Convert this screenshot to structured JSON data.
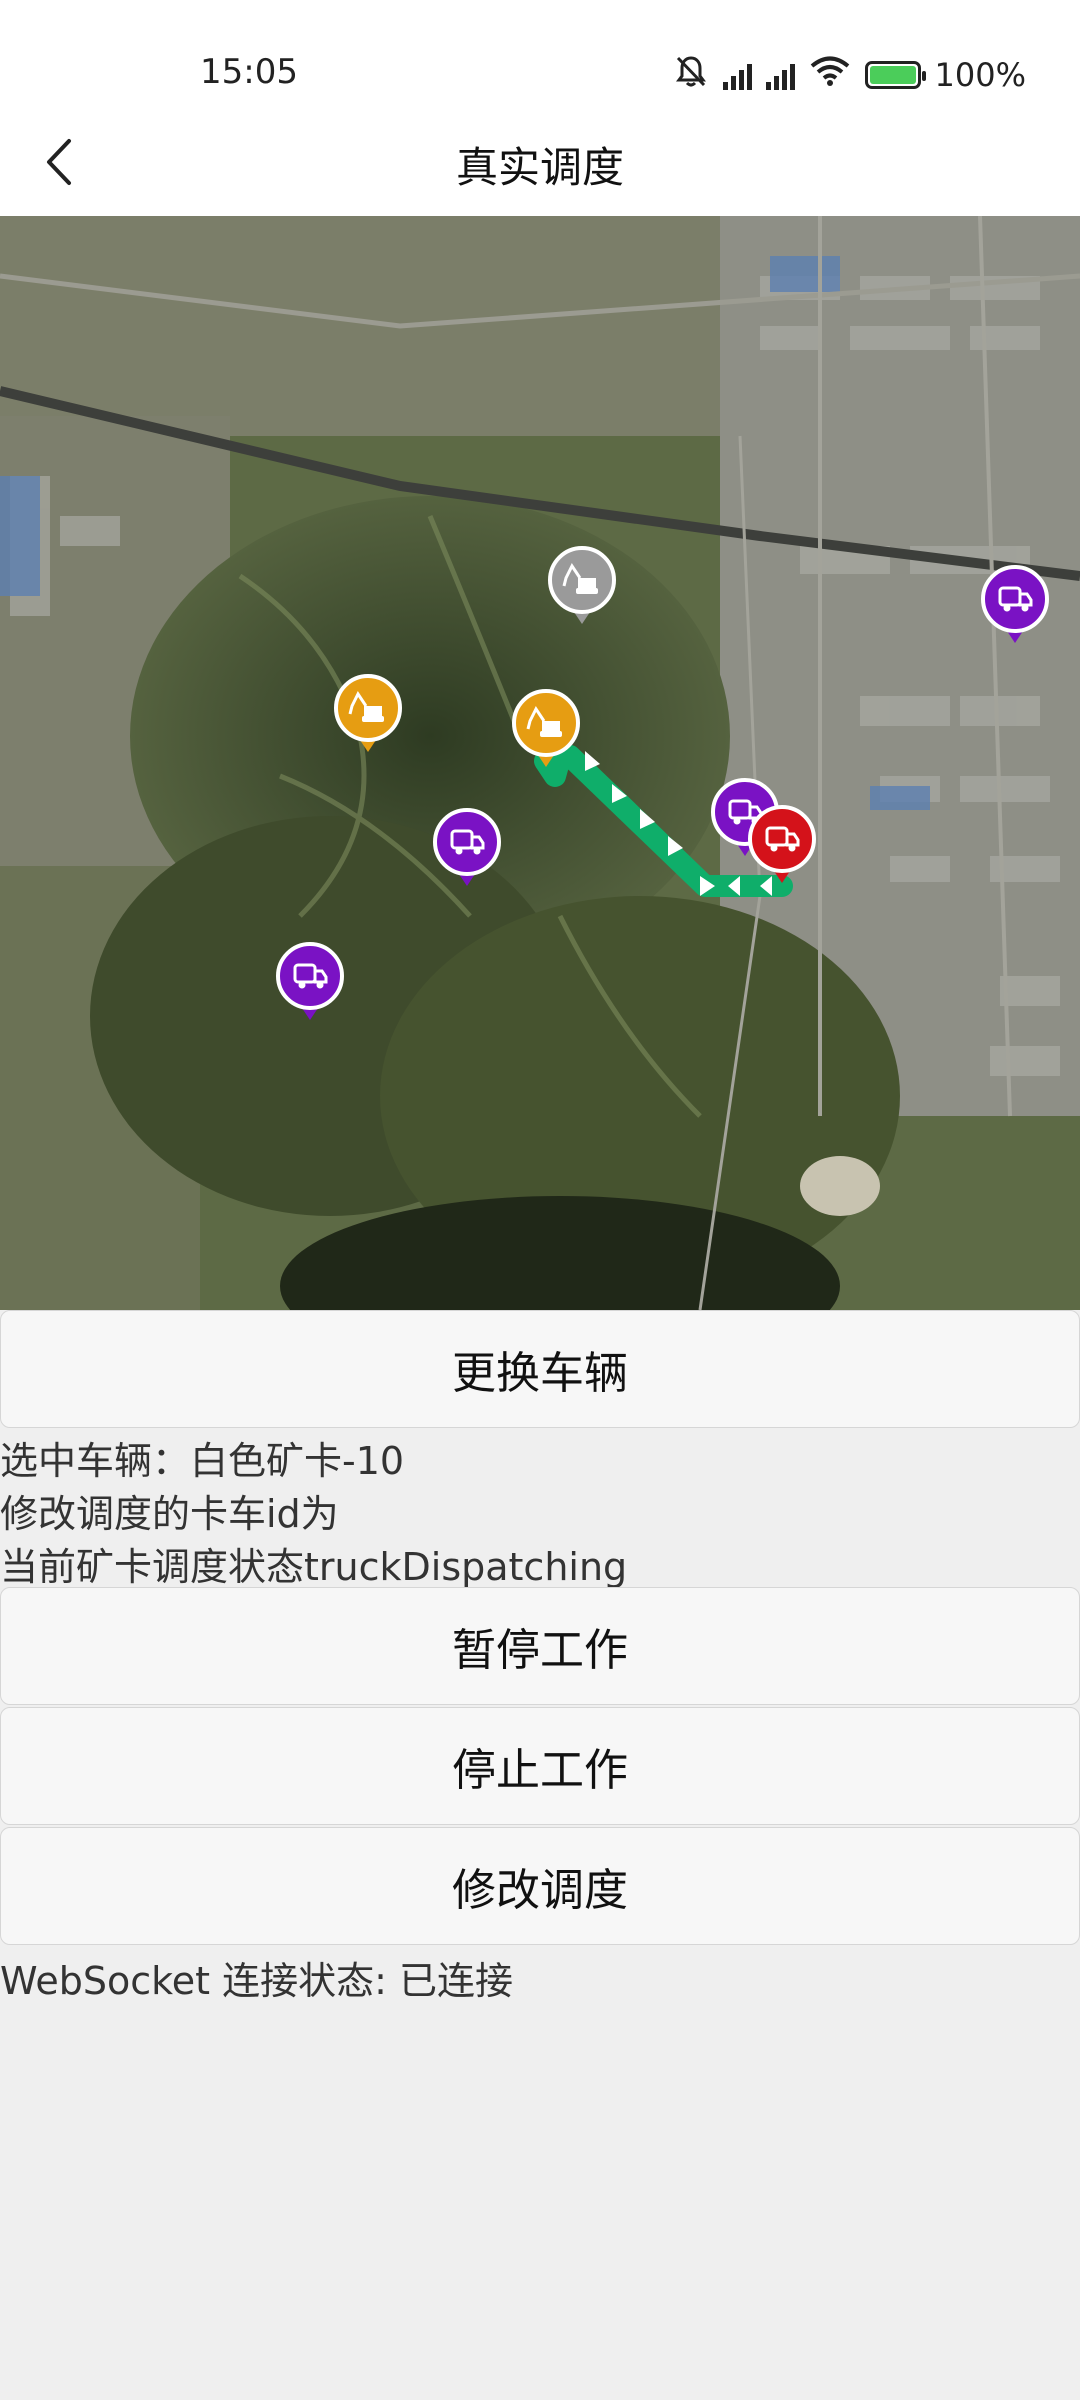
{
  "status_bar": {
    "time": "15:05",
    "icons": [
      "bell-off-icon",
      "hd-signal-icon",
      "hd-signal-icon",
      "wifi-icon",
      "battery-charging-icon"
    ],
    "battery_percent": 100,
    "battery_label": "100%"
  },
  "header": {
    "back_icon": "chevron-left-icon",
    "title": "真实调度"
  },
  "map": {
    "route_color": "#0fae6a",
    "markers": [
      {
        "type": "truck",
        "color": "#7a12c4",
        "icon": "truck-icon"
      },
      {
        "type": "truck",
        "color": "#7a12c4",
        "icon": "truck-icon"
      },
      {
        "type": "truck",
        "color": "#7a12c4",
        "icon": "truck-icon"
      },
      {
        "type": "truck",
        "color": "#7a12c4",
        "icon": "truck-icon"
      },
      {
        "type": "truck",
        "color": "#d4121a",
        "icon": "truck-icon",
        "selected": true
      },
      {
        "type": "excavator",
        "color": "#e69d12",
        "icon": "excavator-icon"
      },
      {
        "type": "excavator",
        "color": "#e69d12",
        "icon": "excavator-icon"
      },
      {
        "type": "excavator",
        "color": "#9a9a9a",
        "icon": "excavator-icon"
      }
    ]
  },
  "actions": {
    "change_vehicle": "更换车辆",
    "pause_work": "暂停工作",
    "stop_work": "停止工作",
    "modify_dispatch": "修改调度"
  },
  "info": {
    "selected_vehicle": "选中车辆：白色矿卡-10",
    "modify_truck_id": "修改调度的卡车id为",
    "dispatch_state": "当前矿卡调度状态truckDispatching",
    "websocket_status": "WebSocket 连接状态: 已连接"
  }
}
